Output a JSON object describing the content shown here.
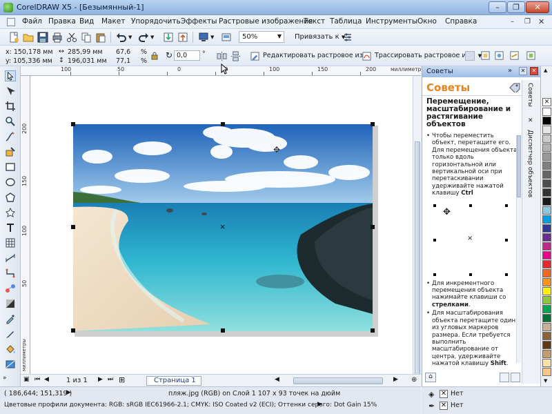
{
  "window": {
    "title": "CorelDRAW X5 - [Безымянный-1]",
    "minimize": "–",
    "restore": "❐",
    "close": "✕"
  },
  "menu": {
    "items": [
      "Файл",
      "Правка",
      "Вид",
      "Макет",
      "Упорядочить",
      "Эффекты",
      "Растровые изображения",
      "Текст",
      "Таблица",
      "Инструменты",
      "Окно",
      "Справка"
    ]
  },
  "toolbar": {
    "zoom_value": "50%",
    "snap_label": "Привязать к"
  },
  "property_bar": {
    "x": "x: 150,178 мм",
    "y": "y: 105,336 мм",
    "width": "285,99 мм",
    "height": "196,031 мм",
    "scale_w": "67,6",
    "scale_h": "77,1",
    "percent": "%",
    "rotation": "0,0",
    "degree": "°",
    "edit_bitmap": "Редактировать растровое из...",
    "trace_bitmap": "Трассировать растровое из."
  },
  "ruler": {
    "top_ticks": [
      "100",
      "50",
      "0",
      "50",
      "100",
      "150",
      "200",
      "250"
    ],
    "units": "миллиметры",
    "left_ticks": [
      "200",
      "150",
      "100",
      "50"
    ],
    "left_units": "миллиметры"
  },
  "page_nav": {
    "counter": "1 из 1",
    "page_tab": "Страница 1"
  },
  "status": {
    "cursor": "( 186,644; 151,319 )",
    "object_info": "пляж.jpg (RGB) on Слой 1 107 x 93 точек на дюйм",
    "color_profile": "Цветовые профили документа: RGB: sRGB IEC61966-2.1; CMYK: ISO Coated v2 (ECI); Оттенки серого: Dot Gain 15%",
    "fill_none": "Нет",
    "outline_none": "Нет"
  },
  "docker": {
    "header": "Советы",
    "title": "Советы",
    "heading": "Перемещение, масштабирование и растягивание объектов",
    "tip1_text": "Чтобы переместить объект, перетащите его. Для перемещения объекта только вдоль горизонтальной или вертикальной оси при перетаскивании удерживайте нажатой клавишу ",
    "tip1_key": "Ctrl",
    "tip2_text": "Для инкрементного перемещения объекта нажимайте клавиши со ",
    "tip2_key": "стрелками",
    "tip3_text": "Для масштабирования объекта перетащите один из угловых маркеров размера. Если требуется выполнить масштабирование от центра, удерживайте нажатой клавишу ",
    "tip3_key": "Shift",
    "tab1": "Советы",
    "tab2": "Диспетчер объектов"
  },
  "palette": {
    "colors": [
      "#ffffff",
      "#000000",
      "#e6e6e6",
      "#cccccc",
      "#b3b3b3",
      "#999999",
      "#808080",
      "#666666",
      "#4d4d4d",
      "#333333",
      "#1a1a1a",
      "#8cc7e0",
      "#00a0e3",
      "#2f3a96",
      "#6a2c91",
      "#bd2a8a",
      "#ec008c",
      "#e8272d",
      "#f26522",
      "#f7941d",
      "#fff200",
      "#8dc63f",
      "#00a651",
      "#007236",
      "#c7b299",
      "#8c6239",
      "#603913",
      "#c69c6d",
      "#f9e1a8",
      "#fdc689"
    ]
  }
}
